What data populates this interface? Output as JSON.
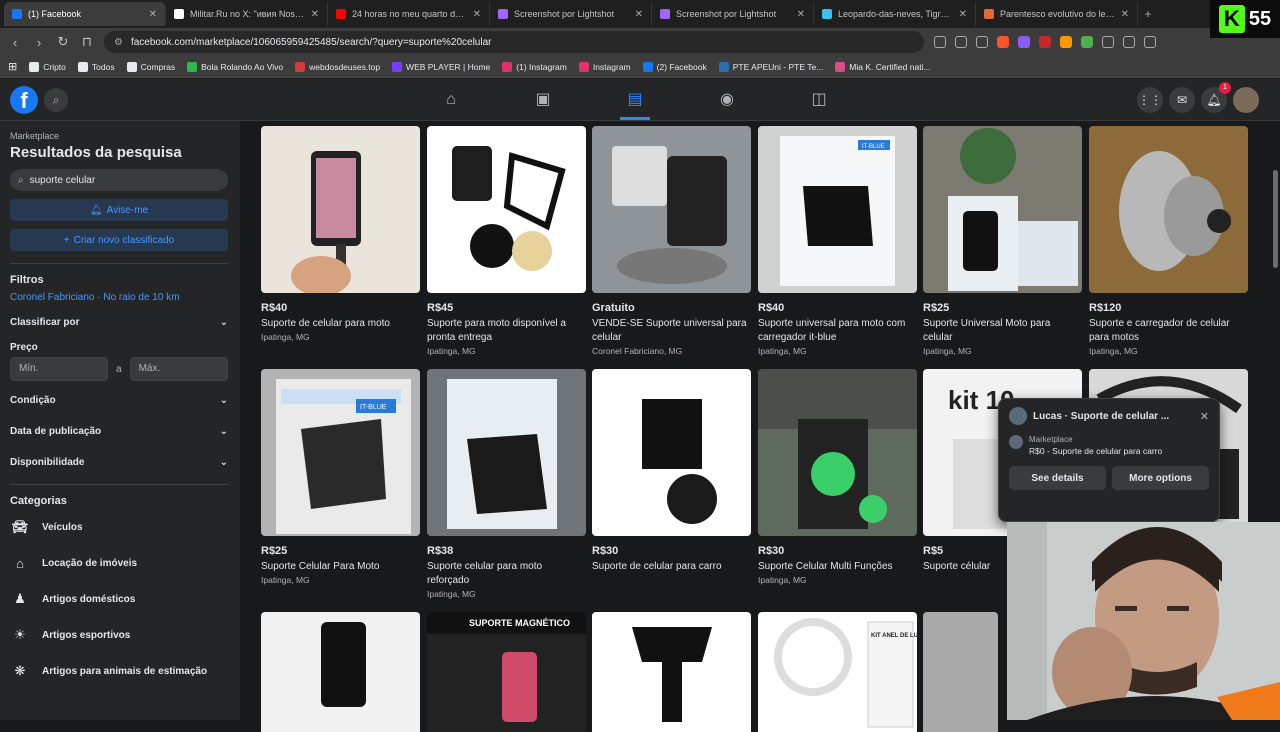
{
  "browser": {
    "tabs": [
      {
        "title": "(1) Facebook",
        "color": "#1877f2",
        "active": true
      },
      {
        "title": "Militar.Ru no X: \"ивия Nosso compa",
        "color": "#ffffff",
        "active": false
      },
      {
        "title": "24 horas no meu quarto de 7ril na C",
        "color": "#ff0000",
        "active": false
      },
      {
        "title": "Screenshot por Lightshot",
        "color": "#a066ff",
        "active": false
      },
      {
        "title": "Screenshot por Lightshot",
        "color": "#a066ff",
        "active": false
      },
      {
        "title": "Leopardo-das-neves, Tigre e Leopa",
        "color": "#36c5f0",
        "active": false
      },
      {
        "title": "Parentesco evolutivo do leopardo-d",
        "color": "#e06a3b",
        "active": false
      }
    ],
    "url": "facebook.com/marketplace/106065959425485/search/?query=suporte%20celular",
    "bookmarks": [
      {
        "label": "Cripto",
        "color": "#e8eaed"
      },
      {
        "label": "Todos",
        "color": "#e8eaed"
      },
      {
        "label": "Compras",
        "color": "#e8eaed"
      },
      {
        "label": "Bola Rolando Ao Vivo",
        "color": "#2fb84a"
      },
      {
        "label": "webdosdeuses.top",
        "color": "#d23a3a"
      },
      {
        "label": "WEB PLAYER | Home",
        "color": "#7a3cff"
      },
      {
        "label": "(1) Instagram",
        "color": "#e1306c"
      },
      {
        "label": "Instagram",
        "color": "#e1306c"
      },
      {
        "label": "(2) Facebook",
        "color": "#1877f2"
      },
      {
        "label": "PTE APEUni - PTE Te...",
        "color": "#2a6fb0"
      },
      {
        "label": "Mia K. Certified nati...",
        "color": "#d94b8a"
      }
    ]
  },
  "kick": {
    "count": "55"
  },
  "facebook": {
    "notif_count": "1",
    "sidebar": {
      "breadcrumb": "Marketplace",
      "title": "Resultados da pesquisa",
      "search_value": "suporte celular",
      "notify_btn": "Avise-me",
      "new_listing_btn": "Criar novo classificado",
      "filters_heading": "Filtros",
      "location": "Coronel Fabriciano · No raio de 10 km",
      "sort_label": "Classificar por",
      "price_label": "Preço",
      "min_placeholder": "Mín.",
      "max_placeholder": "Máx.",
      "price_sep": "a",
      "condition_label": "Condição",
      "date_label": "Data de publicação",
      "availability_label": "Disponibilidade",
      "categories_heading": "Categorias",
      "categories": [
        {
          "label": "Veículos",
          "icon": "car-icon"
        },
        {
          "label": "Locação de imóveis",
          "icon": "house-icon"
        },
        {
          "label": "Artigos domésticos",
          "icon": "lamp-icon"
        },
        {
          "label": "Artigos esportivos",
          "icon": "sport-icon"
        },
        {
          "label": "Artigos para animais de estimação",
          "icon": "paw-icon"
        }
      ]
    },
    "listings": [
      {
        "price": "R$40",
        "title": "Suporte de celular para moto",
        "location": "Ipatinga, MG"
      },
      {
        "price": "R$45",
        "title": "Suporte para moto disponível a pronta entrega",
        "location": "Ipatinga, MG"
      },
      {
        "price": "Gratuito",
        "title": "VENDE-SE Suporte universal para celular",
        "location": "Coronel Fabriciano, MG"
      },
      {
        "price": "R$40",
        "title": "Suporte universal para moto com carregador it-blue",
        "location": "Ipatinga, MG"
      },
      {
        "price": "R$25",
        "title": "Suporte Universal Moto para celular",
        "location": "Ipatinga, MG"
      },
      {
        "price": "R$120",
        "title": "Suporte e carregador de celular para motos",
        "location": "Ipatinga, MG"
      },
      {
        "price": "R$25",
        "title": "Suporte Celular Para Moto",
        "location": "Ipatinga, MG"
      },
      {
        "price": "R$38",
        "title": "Suporte celular para moto reforçado",
        "location": "Ipatinga, MG"
      },
      {
        "price": "R$30",
        "title": "Suporte de celular para carro",
        "location": ""
      },
      {
        "price": "R$30",
        "title": "Suporte Celular Multi Funções",
        "location": "Ipatinga, MG"
      },
      {
        "price": "R$5",
        "title": "Suporte célular",
        "location": ""
      },
      {
        "price": "",
        "title": "",
        "location": ""
      }
    ],
    "thumb_texts": {
      "itblue": "IT-BLUE",
      "kit10": "kit 10",
      "magnetico": "SUPORTE MAGNÉTICO",
      "kitanel": "KIT ANEL DE LUZ COM TRIPÉ"
    },
    "popup": {
      "title": "Lucas · Suporte de celular ...",
      "sub_label": "Marketplace",
      "sub_text": "R$0 - Suporte de celular para carro",
      "btn_details": "See details",
      "btn_more": "More options"
    }
  }
}
